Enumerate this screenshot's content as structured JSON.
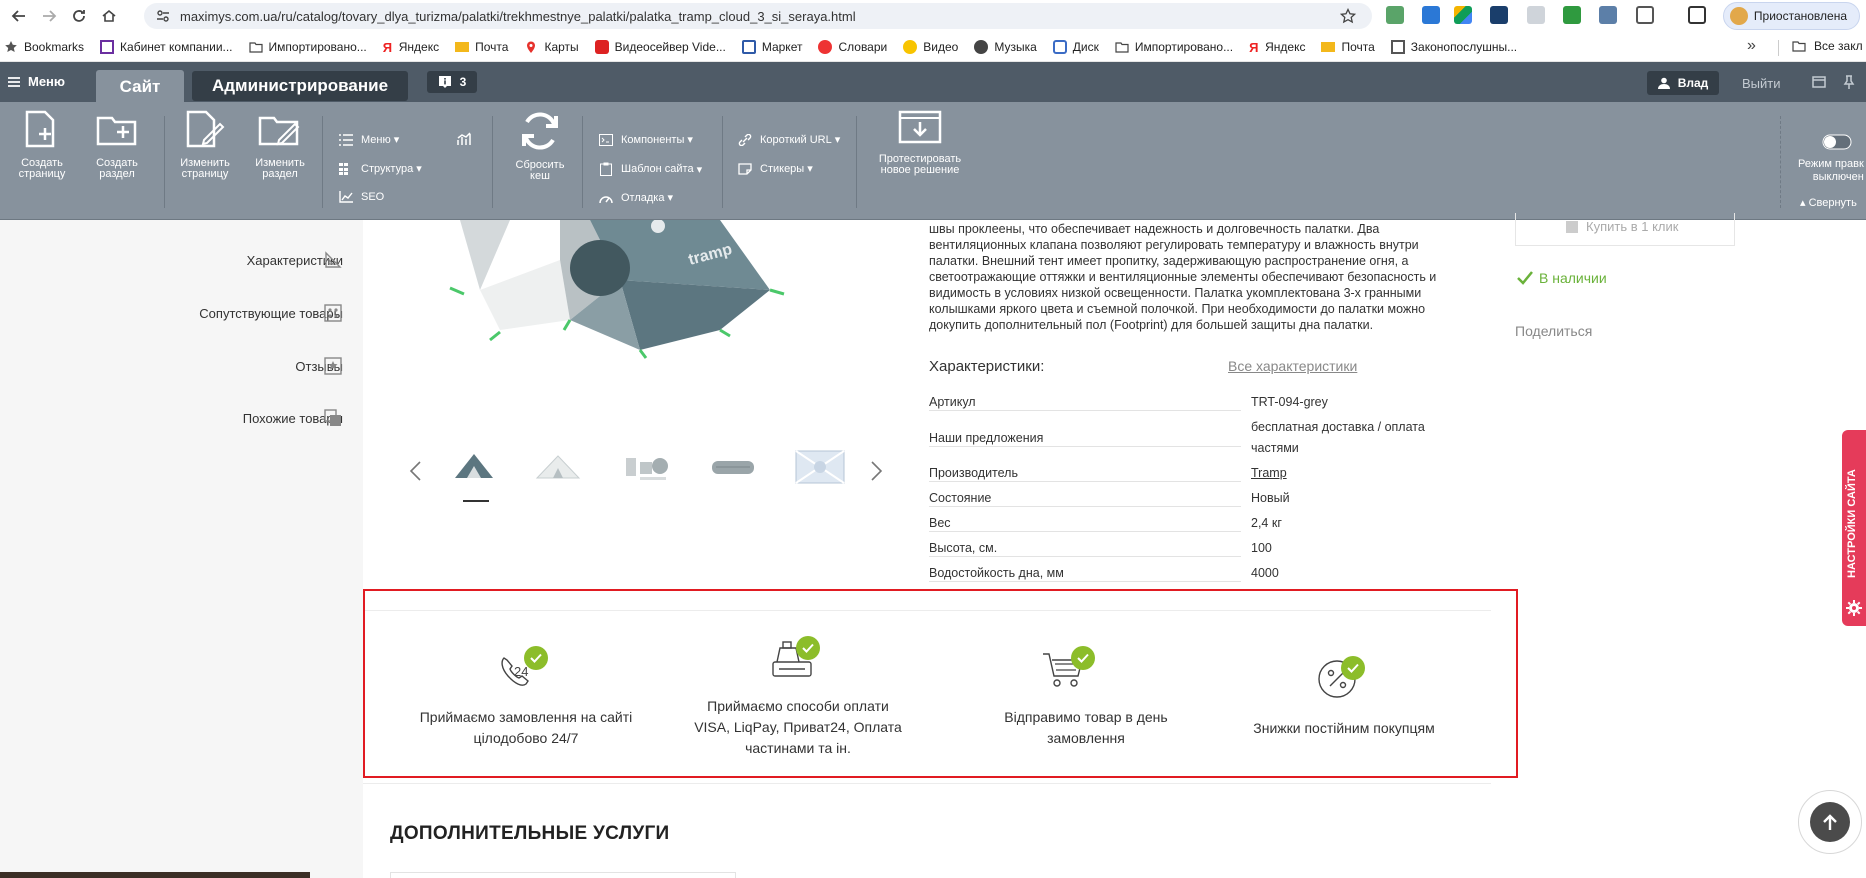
{
  "browser": {
    "url": "maximys.com.ua/ru/catalog/tovary_dlya_turizma/palatki/trekhmestnye_palatki/palatka_tramp_cloud_3_si_seraya.html",
    "profile_label": "Приостановлена",
    "bookmarks": [
      {
        "label": "Bookmarks",
        "icon": "star-icon"
      },
      {
        "label": "Кабинет компании...",
        "icon": "page-icon"
      },
      {
        "label": "Импортировано...",
        "icon": "folder-icon"
      },
      {
        "label": "Яндекс",
        "icon": "yandex-icon"
      },
      {
        "label": "Почта",
        "icon": "mail-icon"
      },
      {
        "label": "Карты",
        "icon": "map-pin-icon"
      },
      {
        "label": "Видеосейвер Vide...",
        "icon": "youtube-icon"
      },
      {
        "label": "Маркет",
        "icon": "market-icon"
      },
      {
        "label": "Словари",
        "icon": "dictionary-icon"
      },
      {
        "label": "Видео",
        "icon": "video-icon"
      },
      {
        "label": "Музыка",
        "icon": "music-icon"
      },
      {
        "label": "Диск",
        "icon": "disk-icon"
      },
      {
        "label": "Импортировано...",
        "icon": "folder-icon"
      },
      {
        "label": "Яндекс",
        "icon": "yandex-icon"
      },
      {
        "label": "Почта",
        "icon": "mail-icon"
      },
      {
        "label": "Законопослушны...",
        "icon": "doc-icon"
      }
    ],
    "bookmarks_more": "»",
    "all_bookmarks": "Все закл"
  },
  "admin": {
    "menu": "Меню",
    "tab_site": "Сайт",
    "tab_admin": "Администрирование",
    "notifications": "3",
    "user": "Влад",
    "logout": "Выйти",
    "tools": {
      "create_page": [
        "Создать",
        "страницу"
      ],
      "create_section": [
        "Создать",
        "раздел"
      ],
      "edit_page": [
        "Изменить",
        "страницу"
      ],
      "edit_section": [
        "Изменить",
        "раздел"
      ],
      "menu": "Меню",
      "structure": "Структура",
      "seo": "SEO",
      "reset_cache": [
        "Сбросить",
        "кеш"
      ],
      "components": "Компоненты",
      "site_template": "Шаблон сайта",
      "debug": "Отладка",
      "short_url": "Короткий URL",
      "stickers": "Стикеры",
      "test_solution": [
        "Протестировать",
        "новое решение"
      ],
      "edit_mode": [
        "Режим правк",
        "выключен"
      ],
      "collapse": "Свернуть"
    }
  },
  "left_nav": [
    {
      "label": "Характеристики",
      "icon": "ruler-triangle-icon"
    },
    {
      "label": "Сопутствующие товары",
      "icon": "grid-dots-icon"
    },
    {
      "label": "Отзывы",
      "icon": "star-box-icon"
    },
    {
      "label": "Похожие товары",
      "icon": "copy-squares-icon"
    }
  ],
  "product": {
    "description": "швы проклеены, что обеспечивает надежность и долговечность палатки. Два вентиляционных клапана позволяют регулировать температуру и влажность внутри палатки. Внешний тент имеет пропитку, задерживающую распространение огня, а светоотражающие оттяжки и вентиляционные элементы обеспечивают безопасность и видимость в условиях низкой освещенности. Палатка укомплектована 3-х гранными колышками яркого цвета и съемной полочкой. При необходимости до палатки можно докупить дополнительный пол (Footprint) для большей защиты дна палатки.",
    "char_title": "Характеристики:",
    "char_all": "Все характеристики",
    "characteristics": [
      {
        "key": "Артикул",
        "value": "TRT-094-grey"
      },
      {
        "key": "Наши предложения",
        "value": "бесплатная доставка / оплата частями"
      },
      {
        "key": "Производитель",
        "value": "Tramp"
      },
      {
        "key": "Состояние",
        "value": "Новый"
      },
      {
        "key": "Вес",
        "value": "2,4 кг"
      },
      {
        "key": "Высота, см.",
        "value": "100"
      },
      {
        "key": "Водостойкость дна, мм",
        "value": "4000"
      }
    ],
    "buy_one_click": "Купить в 1 клик",
    "in_stock": "В наличии",
    "share": "Поделиться",
    "thumbnails": [
      "tent-front-thumb",
      "tent-white-thumb",
      "accessories-thumb",
      "tent-bag-thumb",
      "tent-diagram-thumb"
    ]
  },
  "benefits": [
    {
      "text": "Приймаємо замовлення на сайті цілодобово 24/7",
      "icon": "phone-24-icon"
    },
    {
      "text": "Приймаємо способи оплати VISA, LiqPay, Приват24, Оплата частинами та ін.",
      "icon": "cash-register-icon"
    },
    {
      "text": "Відправимо товар в день замовлення",
      "icon": "cart-icon"
    },
    {
      "text": "Знижки постійним покупцям",
      "icon": "percent-icon"
    }
  ],
  "additional_services": "ДОПОЛНИТЕЛЬНЫЕ УСЛУГИ",
  "site_settings_tab": "НАСТРОЙКИ САЙТА",
  "colors": {
    "admin_dark": "#4f5b67",
    "admin_tools": "#87929d",
    "highlight_red": "#e11b22",
    "check_green": "#8cbd2a",
    "stock_green": "#6ab23a",
    "settings_pink": "#e53b5a"
  }
}
